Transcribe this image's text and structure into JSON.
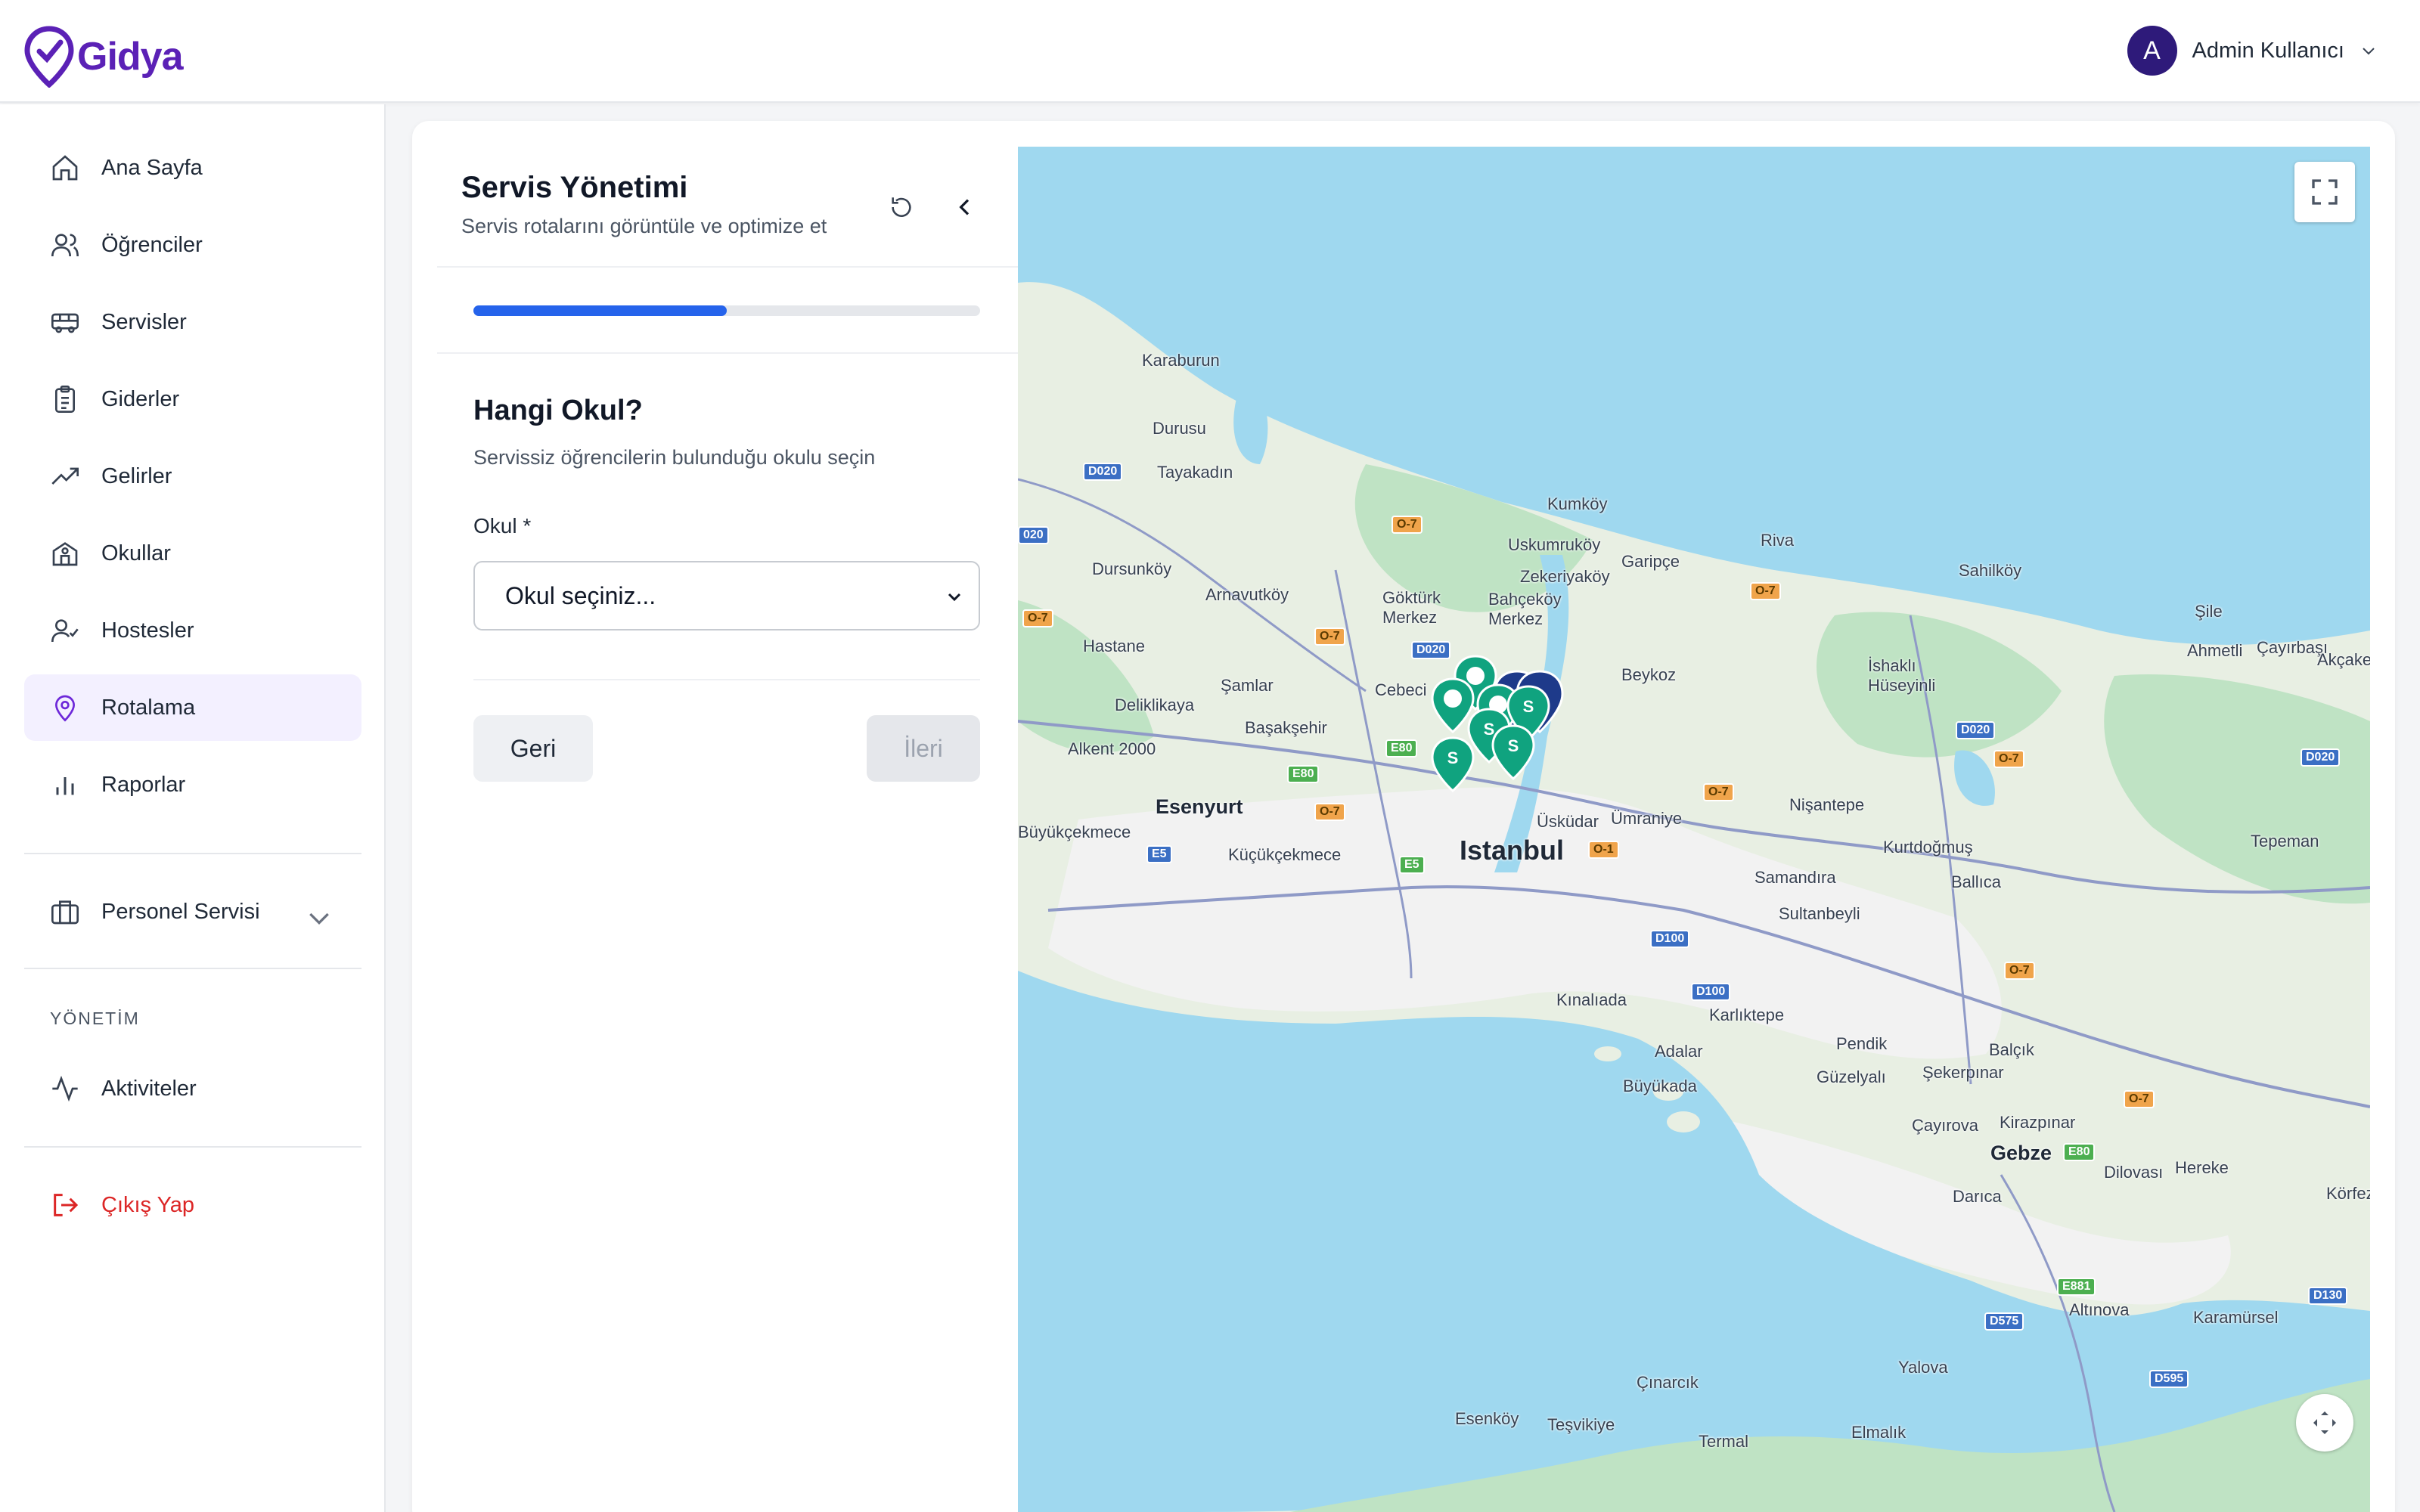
{
  "app": {
    "logo_text": "Gidya",
    "brand_color": "#5b21b6"
  },
  "user": {
    "initial": "A",
    "name": "Admin Kullanıcı"
  },
  "sidebar": {
    "items": [
      {
        "label": "Ana Sayfa",
        "icon": "home-icon"
      },
      {
        "label": "Öğrenciler",
        "icon": "users-icon"
      },
      {
        "label": "Servisler",
        "icon": "bus-icon"
      },
      {
        "label": "Giderler",
        "icon": "clipboard-icon"
      },
      {
        "label": "Gelirler",
        "icon": "trending-up-icon"
      },
      {
        "label": "Okullar",
        "icon": "school-icon"
      },
      {
        "label": "Hostesler",
        "icon": "user-check-icon"
      },
      {
        "label": "Rotalama",
        "icon": "map-pin-icon",
        "active": true
      },
      {
        "label": "Raporlar",
        "icon": "bar-chart-icon"
      }
    ],
    "personnel": {
      "label": "Personel Servisi",
      "icon": "briefcase-icon"
    },
    "section_label": "YÖNETİM",
    "activities": {
      "label": "Aktiviteler",
      "icon": "activity-icon"
    },
    "logout": {
      "label": "Çıkış Yap",
      "icon": "logout-icon",
      "color": "#dc2626"
    }
  },
  "panel": {
    "title": "Servis Yönetimi",
    "subtitle": "Servis rotalarını görüntüle ve optimize et",
    "progress_fraction": 0.5,
    "question_title": "Hangi Okul?",
    "question_subtitle": "Servissiz öğrencilerin bulunduğu okulu seçin",
    "field_label": "Okul *",
    "select_value": "Okul seçiniz...",
    "back_label": "Geri",
    "next_label": "İleri",
    "progress_color": "#2563eb"
  },
  "map": {
    "labels": {
      "karaburun": "Karaburun",
      "durusu": "Durusu",
      "tayakadin": "Tayakadın",
      "kumkoy": "Kumköy",
      "uskumrukoy": "Uskumruköy",
      "garipce": "Garipçe",
      "riva": "Riva",
      "sahilkoy": "Sahilköy",
      "sile": "Şile",
      "ahmetli": "Ahmetli",
      "cayirbasi": "Çayırbaşı",
      "akcakese": "Akçakese",
      "dursunkoy": "Dursunköy",
      "arnavutkoy": "Arnavutköy",
      "gokturk": "Göktürk\nMerkez",
      "bahcekoy": "Bahçeköy\nMerkez",
      "zekeriyakoy": "Zekeriyaköy",
      "hastane": "Hastane",
      "samlar": "Şamlar",
      "cebeci": "Cebeci",
      "beykoz": "Beykoz",
      "ishakli": "İshaklı\nHüseyinli",
      "deliklikaya": "Deliklikaya",
      "basaksehir": "Başakşehir",
      "alkent": "Alkent 2000",
      "esenyurt": "Esenyurt",
      "buyukcekmece": "Büyükçekmece",
      "kucukcekmece": "Küçükçekmece",
      "istanbul": "Istanbul",
      "uskudar": "Üsküdar",
      "umraniye": "Ümraniye",
      "nisantepe": "Nişantepe",
      "kurtdogmus": "Kurtdoğmuş",
      "ballica": "Ballıca",
      "tepeman": "Tepeman",
      "samandira": "Samandıra",
      "sultanbeyli": "Sultanbeyli",
      "kinaliada": "Kınalıada",
      "karliktepe": "Karlıktepe",
      "adalar": "Adalar",
      "buyukada": "Büyükada",
      "pendik": "Pendik",
      "guzelyali": "Güzelyalı",
      "balcik": "Balçık",
      "sekerpinar": "Şekerpınar",
      "cayirova": "Çayırova",
      "kirazpinar": "Kirazpınar",
      "gebze": "Gebze",
      "darica": "Darıca",
      "dilovasi": "Dilovası",
      "hereke": "Hereke",
      "korfez": "Körfez",
      "altinova": "Altınova",
      "karamursel": "Karamürsel",
      "yalova": "Yalova",
      "cinarcik": "Çınarcık",
      "esenkoy": "Esenköy",
      "tesvikiye": "Teşvikiye",
      "termal": "Termal",
      "elmalik": "Elmalık"
    },
    "roads": [
      "D020",
      "D020",
      "D020",
      "D020",
      "020",
      "O-7",
      "O-7",
      "O-7",
      "O-7",
      "O-7",
      "O-7",
      "O-7",
      "O-7",
      "O-7",
      "O-1",
      "E80",
      "E80",
      "E5",
      "E5",
      "D100",
      "D100",
      "E80",
      "E881",
      "D575",
      "D595",
      "D130"
    ],
    "colors": {
      "water": "#9fd8ef",
      "land": "#e8efe3",
      "forest": "#bfe3c4",
      "urban": "#f2f2f2",
      "pin_green": "#10a37f",
      "pin_blue": "#1e3a8a"
    }
  }
}
